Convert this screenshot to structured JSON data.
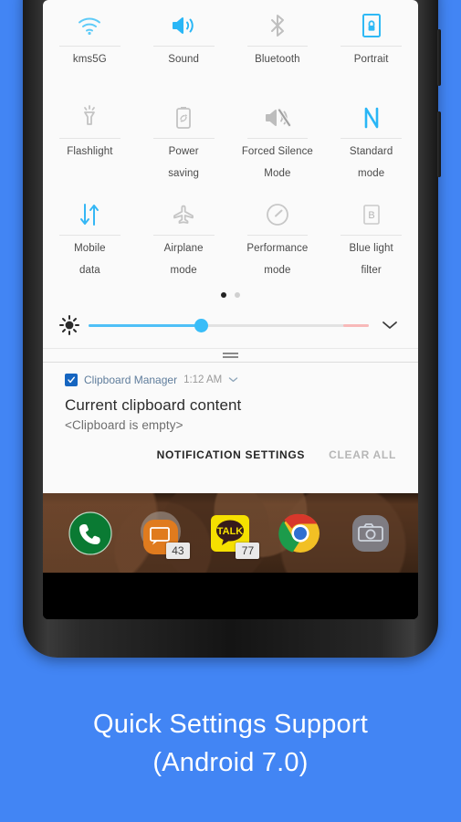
{
  "caption": {
    "line1": "Quick Settings Support",
    "line2": "(Android 7.0)"
  },
  "colors": {
    "background_blue": "#4285F4",
    "accent_blue": "#2fb9f5",
    "panel_background": "#FAFAFA",
    "inactive_icon": "#bdbdbd"
  },
  "quick_settings": {
    "tiles": [
      {
        "icon": "wifi-icon",
        "label": "kms5G",
        "state": "on"
      },
      {
        "icon": "sound-icon",
        "label": "Sound",
        "state": "on"
      },
      {
        "icon": "bluetooth-icon",
        "label": "Bluetooth",
        "state": "off"
      },
      {
        "icon": "portrait-lock-icon",
        "label": "Portrait",
        "state": "on"
      },
      {
        "icon": "flashlight-icon",
        "label": "Flashlight",
        "state": "off"
      },
      {
        "icon": "power-saving-icon",
        "label": "Power\nsaving",
        "state": "off"
      },
      {
        "icon": "forced-silence-icon",
        "label": "Forced Silence\nMode",
        "state": "off"
      },
      {
        "icon": "nfc-icon",
        "label": "Standard\nmode",
        "state": "on"
      },
      {
        "icon": "mobile-data-icon",
        "label": "Mobile\ndata",
        "state": "on"
      },
      {
        "icon": "airplane-mode-icon",
        "label": "Airplane\nmode",
        "state": "off"
      },
      {
        "icon": "performance-mode-icon",
        "label": "Performance\nmode",
        "state": "off"
      },
      {
        "icon": "blue-light-filter-icon",
        "label": "Blue light\nfilter",
        "state": "off"
      }
    ],
    "tile_labels_row1": [
      "kms5G",
      "Sound",
      "Bluetooth",
      "Portrait"
    ],
    "tile_labels_row2_top": [
      "Flashlight",
      "Power",
      "Forced Silence",
      "Standard"
    ],
    "tile_labels_row2_bottom": [
      "",
      "saving",
      "Mode",
      "mode"
    ],
    "tile_labels_row3_top": [
      "Mobile",
      "Airplane",
      "Performance",
      "Blue light"
    ],
    "tile_labels_row3_bottom": [
      "data",
      "mode",
      "mode",
      "filter"
    ],
    "pages": {
      "total": 2,
      "current": 1
    },
    "brightness": {
      "icon": "brightness-icon",
      "value_percent": 40,
      "expand_icon": "chevron-down-icon"
    },
    "drag_handle": "panel-drag-handle"
  },
  "notification": {
    "app_icon": "clipboard-icon",
    "app_name": "Clipboard Manager",
    "time": "1:12 AM",
    "expand_icon": "chevron-down-icon",
    "title": "Current clipboard content",
    "body": "<Clipboard is empty>",
    "actions": {
      "settings_label": "NOTIFICATION SETTINGS",
      "clear_label": "CLEAR ALL"
    }
  },
  "dock": {
    "apps": [
      {
        "name": "phone-app",
        "badge": ""
      },
      {
        "name": "messages-app",
        "badge": "43"
      },
      {
        "name": "kakaotalk-app",
        "badge": "77",
        "glyph": "TALK"
      },
      {
        "name": "chrome-app",
        "badge": ""
      },
      {
        "name": "camera-app",
        "badge": ""
      }
    ]
  }
}
